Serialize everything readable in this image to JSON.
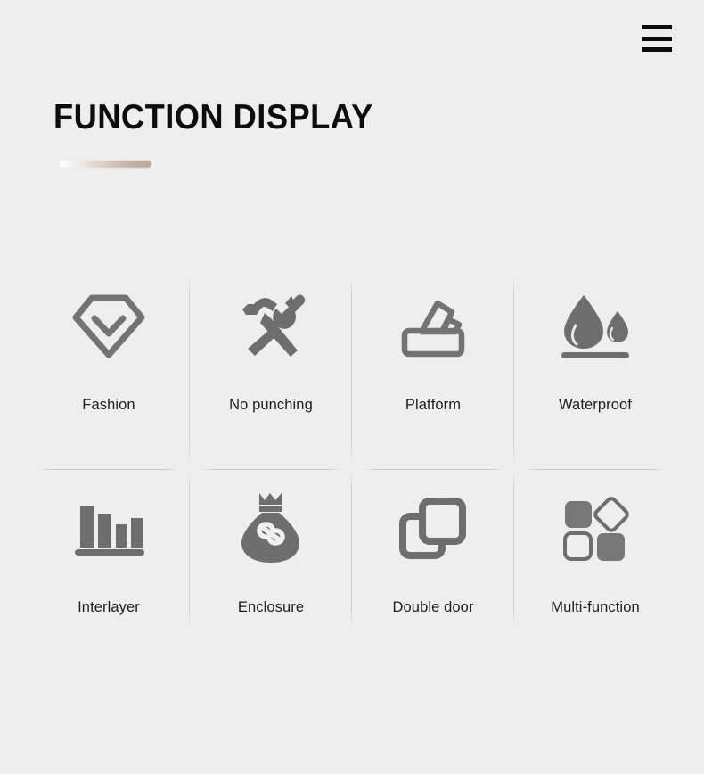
{
  "page": {
    "background_color": "#eeeeee",
    "accent_color": "#bfa99c",
    "icon_color": "#6e6e6e",
    "text_color": "#1d1d1d"
  },
  "header": {
    "menu_icon": "hamburger-menu-icon",
    "menu_label": "Menu",
    "menu_color": "#0b0b0b"
  },
  "title": {
    "text": "FUNCTION DISPLAY",
    "underline": "gradient-bar"
  },
  "features": [
    {
      "label": "Fashion",
      "icon": "diamond-gem-icon"
    },
    {
      "label": "No punching",
      "icon": "hammer-wrench-icon"
    },
    {
      "label": "Platform",
      "icon": "tissue-box-icon"
    },
    {
      "label": "Waterproof",
      "icon": "water-drops-icon"
    },
    {
      "label": "Interlayer",
      "icon": "bar-layers-icon"
    },
    {
      "label": "Enclosure",
      "icon": "money-bag-link-icon"
    },
    {
      "label": "Double door",
      "icon": "overlapping-squares-icon"
    },
    {
      "label": "Multi-function",
      "icon": "four-shapes-icon"
    }
  ]
}
